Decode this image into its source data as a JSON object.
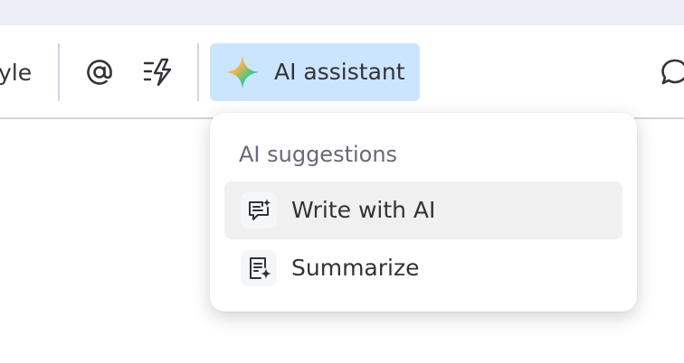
{
  "toolbar": {
    "style_label": "yle",
    "ai_button_label": "AI assistant",
    "icons": [
      "at-icon",
      "lightning-list-icon",
      "sparkle-icon",
      "chat-icon"
    ]
  },
  "ai_menu": {
    "title": "AI suggestions",
    "items": [
      {
        "label": "Write with AI",
        "icon": "write-ai-icon",
        "highlighted": true
      },
      {
        "label": "Summarize",
        "icon": "summarize-icon",
        "highlighted": false
      }
    ]
  },
  "colors": {
    "ai_button_bg": "#cce5ff",
    "top_strip": "#eceff8",
    "menu_hover": "#f0f0f0",
    "text": "#323338",
    "muted_text": "#676879"
  }
}
